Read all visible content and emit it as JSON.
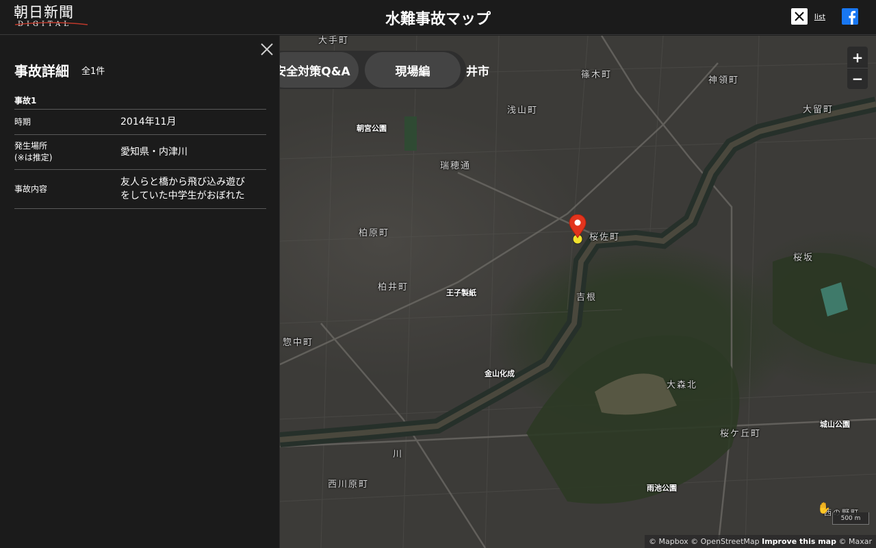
{
  "header": {
    "logo_brand": "朝日新聞",
    "logo_sub": "DIGITAL",
    "title": "水難事故マップ",
    "share_list": "list",
    "icons": {
      "x": "x-logo-icon",
      "facebook": "facebook-icon"
    }
  },
  "sidebar": {
    "title": "事故詳細",
    "count": "全1件",
    "incidents": [
      {
        "name": "事故1",
        "rows": [
          {
            "key": "時期",
            "value": "2014年11月"
          },
          {
            "key_line1": "発生場所",
            "key_line2": "(※は推定)",
            "value": "愛知県・内津川"
          },
          {
            "key": "事故内容",
            "value_line1": "友人らと橋から飛び込み遊び",
            "value_line2": "をしていた中学生がおぼれた"
          }
        ]
      }
    ]
  },
  "map": {
    "tabs": [
      "安全対策Q&A",
      "現場編"
    ],
    "city_fragment": "井市",
    "zoom_in": "+",
    "zoom_out": "−",
    "scale": "500 m",
    "attribution_1": "© Mapbox © OpenStreetMap",
    "attribution_2": "Improve this map",
    "attribution_3": "© Maxar",
    "labels": [
      "大手町",
      "篠木町",
      "神領町",
      "浅山町",
      "大留町",
      "朝宮公園",
      "瑞穂通",
      "桜佐町",
      "柏原町",
      "桜坂",
      "柏井町",
      "王子製紙",
      "吉根",
      "惣中町",
      "金山化成",
      "大森北",
      "城山公園",
      "桜ケ丘町",
      "川",
      "西川原町",
      "雨池公園",
      "西の野町"
    ],
    "colors": {
      "pin": "#e2341d",
      "marker": "#f2e22e",
      "river": "#26302a"
    }
  }
}
